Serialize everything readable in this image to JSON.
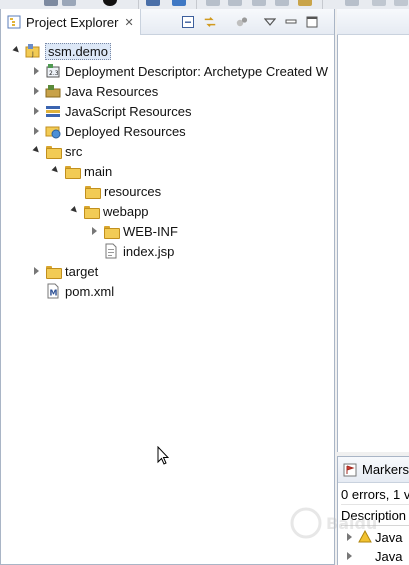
{
  "project_explorer": {
    "tab_title": "Project Explorer",
    "tab_close": "✕",
    "header_buttons": [
      {
        "name": "collapse-all-icon"
      },
      {
        "name": "link-with-editor-icon"
      },
      {
        "name": "filter-icon"
      },
      {
        "name": "view-menu-icon"
      },
      {
        "name": "minimize-icon"
      },
      {
        "name": "maximize-icon"
      }
    ],
    "tree": [
      {
        "label": "ssm.demo",
        "icon": "project-icon",
        "expanded": true,
        "selected": true
      },
      {
        "label": "Deployment Descriptor: Archetype Created W",
        "icon": "deployment-descriptor-icon",
        "expanded": false
      },
      {
        "label": "Java Resources",
        "icon": "java-resources-icon",
        "expanded": false
      },
      {
        "label": "JavaScript Resources",
        "icon": "javascript-resources-icon",
        "expanded": false
      },
      {
        "label": "Deployed Resources",
        "icon": "deployed-resources-icon",
        "expanded": false
      },
      {
        "label": "src",
        "icon": "folder-icon",
        "expanded": true
      },
      {
        "label": "main",
        "icon": "folder-icon",
        "expanded": true
      },
      {
        "label": "resources",
        "icon": "folder-icon"
      },
      {
        "label": "webapp",
        "icon": "folder-icon",
        "expanded": true
      },
      {
        "label": "WEB-INF",
        "icon": "folder-icon",
        "expanded": false
      },
      {
        "label": "index.jsp",
        "icon": "jsp-file-icon"
      },
      {
        "label": "target",
        "icon": "folder-icon",
        "expanded": false
      },
      {
        "label": "pom.xml",
        "icon": "maven-pom-icon"
      }
    ]
  },
  "markers": {
    "tab_title": "Markers",
    "summary": "0 errors, 1 v",
    "column_description": "Description",
    "rows": [
      {
        "label": "Java"
      },
      {
        "label": "Java"
      }
    ]
  },
  "watermark": {
    "text": "Baidu"
  }
}
